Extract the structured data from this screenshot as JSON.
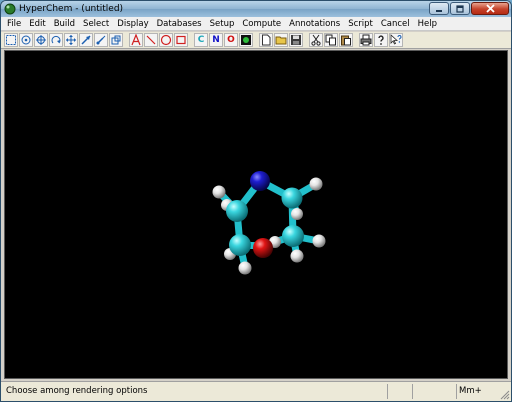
{
  "window": {
    "title": "HyperChem - (untitled)"
  },
  "menu": [
    "File",
    "Edit",
    "Build",
    "Select",
    "Display",
    "Databases",
    "Setup",
    "Compute",
    "Annotations",
    "Script",
    "Cancel",
    "Help"
  ],
  "toolbar": {
    "element_buttons": [
      "C",
      "N",
      "O"
    ]
  },
  "status": {
    "message": "Choose among rendering options",
    "mode": "Mm+"
  },
  "colors": {
    "viewport_bg": "#000000",
    "carbon": "#21c4cf",
    "nitrogen": "#1414c8",
    "oxygen": "#d01010",
    "hydrogen": "#e8e8e8"
  }
}
